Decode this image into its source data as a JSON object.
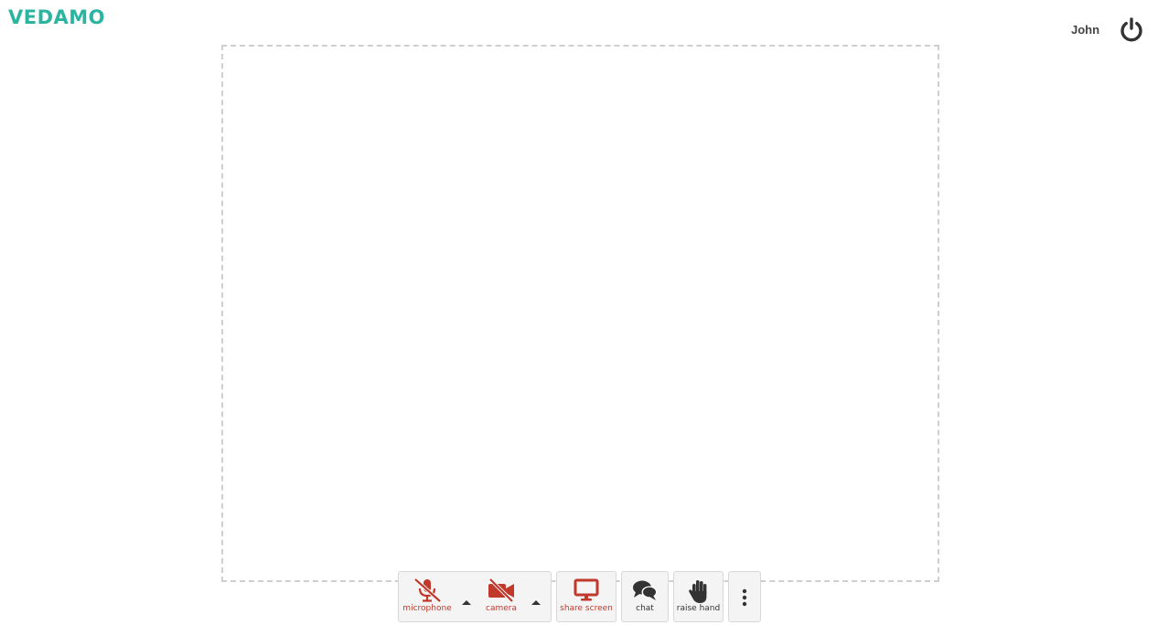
{
  "header": {
    "logo_text": "VEDAMO",
    "user_name": "John"
  },
  "toolbar": {
    "microphone_label": "microphone",
    "camera_label": "camera",
    "share_screen_label": "share screen",
    "chat_label": "chat",
    "raise_hand_label": "raise hand"
  },
  "colors": {
    "brand": "#2bb5a0",
    "muted_red": "#c0392b",
    "icon_dark": "#333333"
  },
  "icons": {
    "power": "power-icon",
    "microphone": "microphone-off-icon",
    "camera": "camera-off-icon",
    "share_screen": "monitor-icon",
    "chat": "chat-bubbles-icon",
    "raise_hand": "hand-icon",
    "more": "more-vertical-icon"
  }
}
